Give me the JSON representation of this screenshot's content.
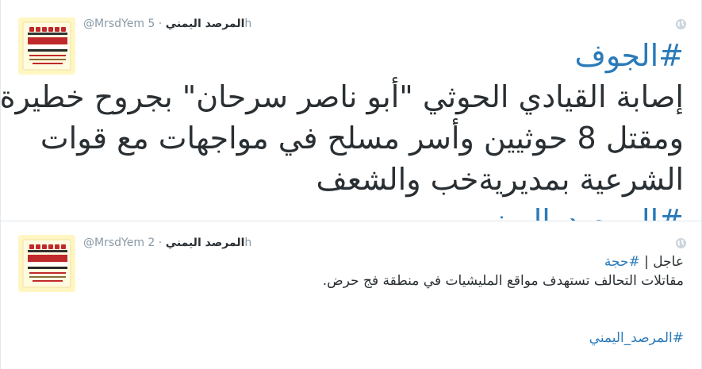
{
  "tweets": [
    {
      "screen_name": "@MrsdYem",
      "display_name": "المرصد اليمني",
      "separator": "·",
      "time": "5h",
      "hashtag_top": "#الجوف",
      "lines": [
        "إصابة القيادي الحوثي \"أبو ناصر سرحان\" بجروح خطيرة",
        "ومقتل 8 حوثيين وأسر مسلح في مواجهات مع قوات",
        "الشرعية بمديريةخب والشعف"
      ],
      "hashtag_bottom": "#المرصد_اليمني"
    },
    {
      "screen_name": "@MrsdYem",
      "display_name": "المرصد اليمني",
      "separator": "·",
      "time": "2h",
      "prefix": "عاجل |",
      "hashtag_top": "#حجة",
      "line": "مقاتلات التحالف تستهدف مواقع المليشيات في منطقة فج حرض.",
      "hashtag_bottom": "#المرصد_اليمني"
    }
  ],
  "avatar": {
    "label_ar": "المرصد اليمني",
    "label_en": "Yemeni Observatory"
  },
  "colors": {
    "link": "#2b7bb9",
    "text": "#292f33",
    "meta": "#8899a6",
    "border": "#e1e8ed"
  },
  "icons": {
    "globe": "globe-icon"
  }
}
